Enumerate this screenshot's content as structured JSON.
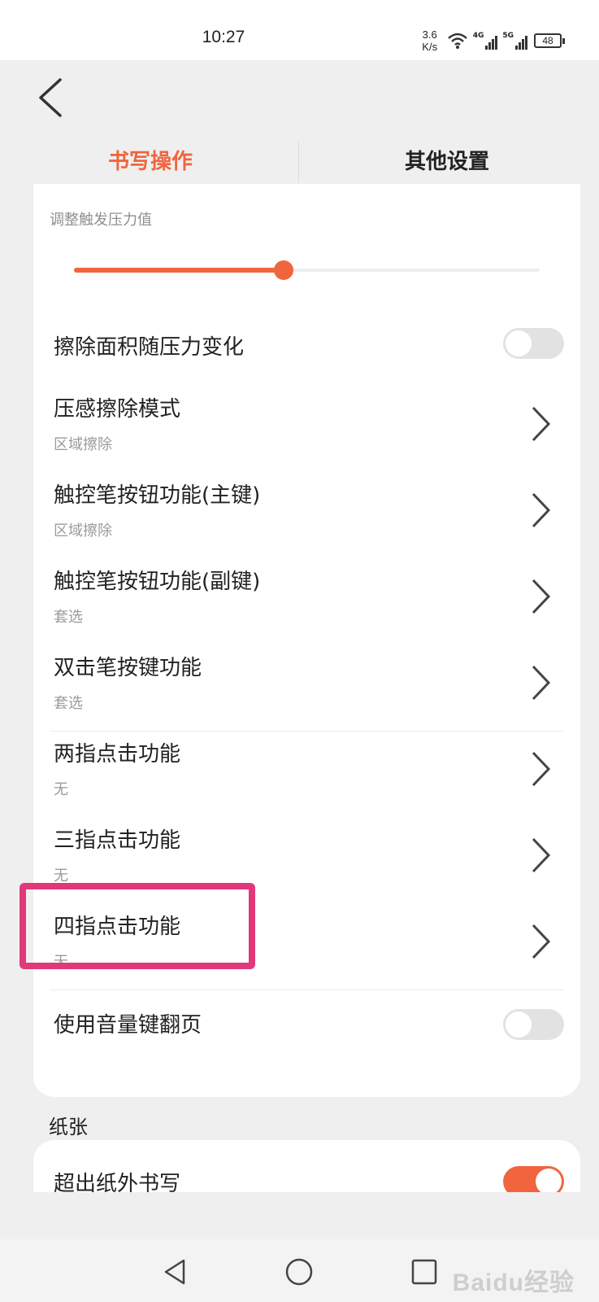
{
  "status_bar": {
    "time": "10:27",
    "speed_value": "3.6",
    "speed_unit": "K/s",
    "network_1": "4G",
    "network_2": "5G",
    "battery": "48"
  },
  "tabs": [
    {
      "label": "书写操作",
      "active": true
    },
    {
      "label": "其他设置",
      "active": false
    }
  ],
  "writing": {
    "pressure_label": "调整触发压力值",
    "pressure_value_fraction": 0.45,
    "erase_area_pressure": {
      "label": "擦除面积随压力变化",
      "enabled": false
    },
    "pressure_erase_mode": {
      "label": "压感擦除模式",
      "value": "区域擦除"
    },
    "pen_button_primary": {
      "label": "触控笔按钮功能(主键)",
      "value": "区域擦除"
    },
    "pen_button_secondary": {
      "label": "触控笔按钮功能(副键)",
      "value": "套选"
    },
    "double_tap_pen": {
      "label": "双击笔按键功能",
      "value": "套选"
    },
    "two_finger_tap": {
      "label": "两指点击功能",
      "value": "无"
    },
    "three_finger_tap": {
      "label": "三指点击功能",
      "value": "无"
    },
    "four_finger_tap": {
      "label": "四指点击功能",
      "value": "无"
    },
    "volume_key_page": {
      "label": "使用音量键翻页",
      "enabled": false
    }
  },
  "paper_section": {
    "label": "纸张",
    "write_outside": {
      "label": "超出纸外书写",
      "enabled": true
    }
  },
  "colors": {
    "accent": "#f0653e",
    "highlight": "#e0387a"
  },
  "watermark": "Baidu经验"
}
